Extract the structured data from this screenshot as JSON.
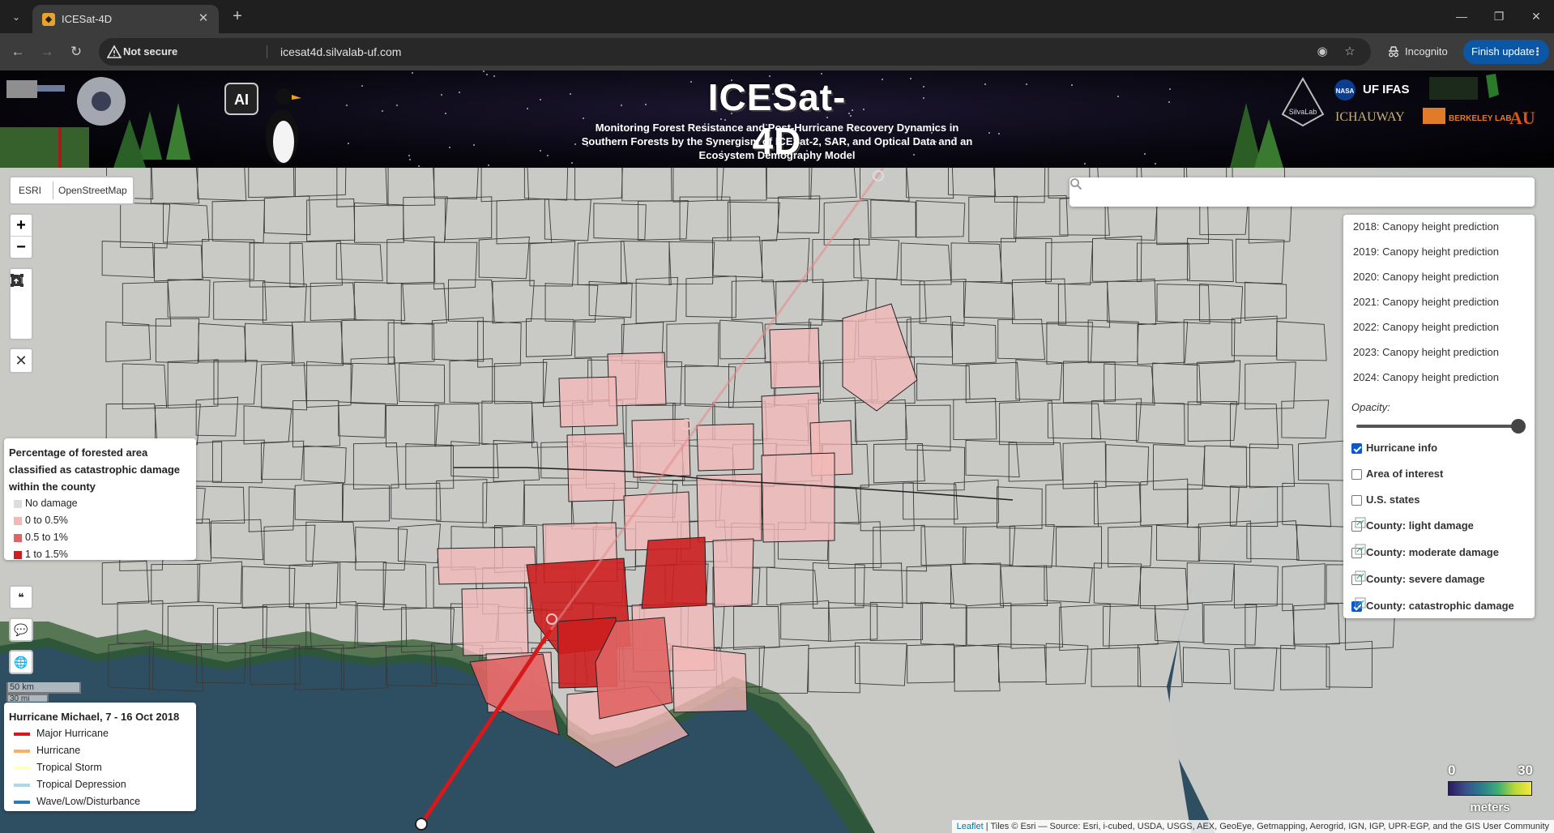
{
  "browser": {
    "tab_title": "ICESat-4D",
    "security_label": "Not secure",
    "url": "icesat4d.silvalab-uf.com",
    "incognito_label": "Incognito",
    "finish_update_label": "Finish update"
  },
  "banner": {
    "title": "ICESat-4D",
    "subtitle_lines": [
      "Monitoring Forest Resistance and Post-Hurricane Recovery Dynamics in",
      "Southern Forests by the Synergism of ICESat-2, SAR, and Optical Data and an",
      "Ecosystem Demography Model"
    ],
    "ai_badge": "AI",
    "logos": [
      "SilvaLab",
      "NASA",
      "UF IFAS",
      "ICHAUWAY",
      "BERKELEY LAB"
    ]
  },
  "basemap": {
    "options": [
      "ESRI",
      "OpenStreetMap"
    ]
  },
  "zoom": {
    "in": "+",
    "out": "−"
  },
  "damage_legend": {
    "title_lines": [
      "Percentage of forested area",
      "classified as catastrophic damage",
      "within the county"
    ],
    "items": [
      {
        "label": "No damage",
        "color": "#dddddd"
      },
      {
        "label": "0 to 0.5%",
        "color": "#f2b8b8"
      },
      {
        "label": "0.5 to 1%",
        "color": "#e06464"
      },
      {
        "label": "1 to 1.5%",
        "color": "#cc1f1f"
      }
    ]
  },
  "scale": {
    "km": "50 km",
    "mi": "30 mi"
  },
  "hurricane_legend": {
    "title": "Hurricane Michael, 7 - 16 Oct 2018",
    "items": [
      {
        "label": "Major Hurricane",
        "color": "#d7191c"
      },
      {
        "label": "Hurricane",
        "color": "#fdae61"
      },
      {
        "label": "Tropical Storm",
        "color": "#ffffbf"
      },
      {
        "label": "Tropical Depression",
        "color": "#abd9e9"
      },
      {
        "label": "Wave/Low/Disturbance",
        "color": "#2c7bb6"
      }
    ]
  },
  "search": {
    "placeholder": ""
  },
  "layers": {
    "canopy": [
      "2018: Canopy height prediction",
      "2019: Canopy height prediction",
      "2020: Canopy height prediction",
      "2021: Canopy height prediction",
      "2022: Canopy height prediction",
      "2023: Canopy height prediction",
      "2024: Canopy height prediction"
    ],
    "opacity_label": "Opacity:",
    "opacity_value": 1.0,
    "overlays": [
      {
        "label": "Hurricane info",
        "checked": true,
        "has_img": false
      },
      {
        "label": "Area of interest",
        "checked": false,
        "has_img": false
      },
      {
        "label": "U.S. states",
        "checked": false,
        "has_img": false
      },
      {
        "label": "County: light damage",
        "checked": false,
        "has_img": true
      },
      {
        "label": "County: moderate damage",
        "checked": false,
        "has_img": true
      },
      {
        "label": "County: severe damage",
        "checked": false,
        "has_img": true
      },
      {
        "label": "County: catastrophic damage",
        "checked": true,
        "has_img": true
      }
    ]
  },
  "colorbar": {
    "min": "0",
    "max": "30",
    "unit": "meters"
  },
  "attribution": {
    "leaflet": "Leaflet",
    "text": "| Tiles © Esri — Source: Esri, i-cubed, USDA, USGS, AEX, GeoEye, Getmapping, Aerogrid, IGN, IGP, UPR-EGP, and the GIS User Community"
  }
}
